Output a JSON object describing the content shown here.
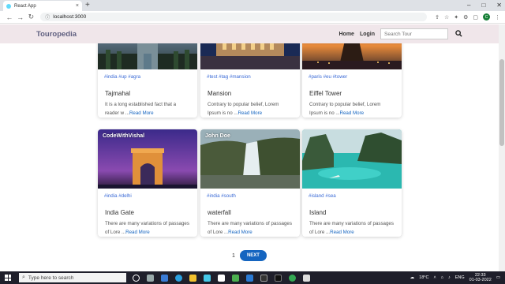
{
  "browser": {
    "tab_title": "React App",
    "tab_close": "×",
    "new_tab": "+",
    "url": "localhost:3000",
    "profile_initial": "C",
    "win_min": "–",
    "win_max": "□",
    "win_close": "✕"
  },
  "nav": {
    "brand": "Touropedia",
    "home": "Home",
    "login": "Login",
    "search_placeholder": "Search Tour"
  },
  "cards": [
    {
      "author": "",
      "tags": "#india #up #agra",
      "title": "Tajmahal",
      "text": "It is a long established fact that a reader w ...",
      "read_more": "Read More"
    },
    {
      "author": "",
      "tags": "#test #tag #mansion",
      "title": "Mansion",
      "text": "Contrary to popular belief, Lorem Ipsum is no ...",
      "read_more": "Read More"
    },
    {
      "author": "",
      "tags": "#paris #eu #tower",
      "title": "Eiffel Tower",
      "text": "Contrary to popular belief, Lorem Ipsum is no ...",
      "read_more": "Read More"
    },
    {
      "author": "CodeWithVishal",
      "tags": "#india #delhi",
      "title": "India Gate",
      "text": "There are many variations of passages of Lore ...",
      "read_more": "Read More"
    },
    {
      "author": "John Doe",
      "tags": "#india #south",
      "title": "waterfall",
      "text": "There are many variations of passages of Lore ...",
      "read_more": "Read More"
    },
    {
      "author": "",
      "tags": "#island #sea",
      "title": "Island",
      "text": "There are many variations of passages of Lore ...",
      "read_more": "Read More"
    }
  ],
  "pagination": {
    "current": "1",
    "next": "NEXT"
  },
  "taskbar": {
    "search_placeholder": "Type here to search",
    "weather": "18°C",
    "lang": "ENG",
    "time": "22:33",
    "date": "01-03-2022"
  }
}
